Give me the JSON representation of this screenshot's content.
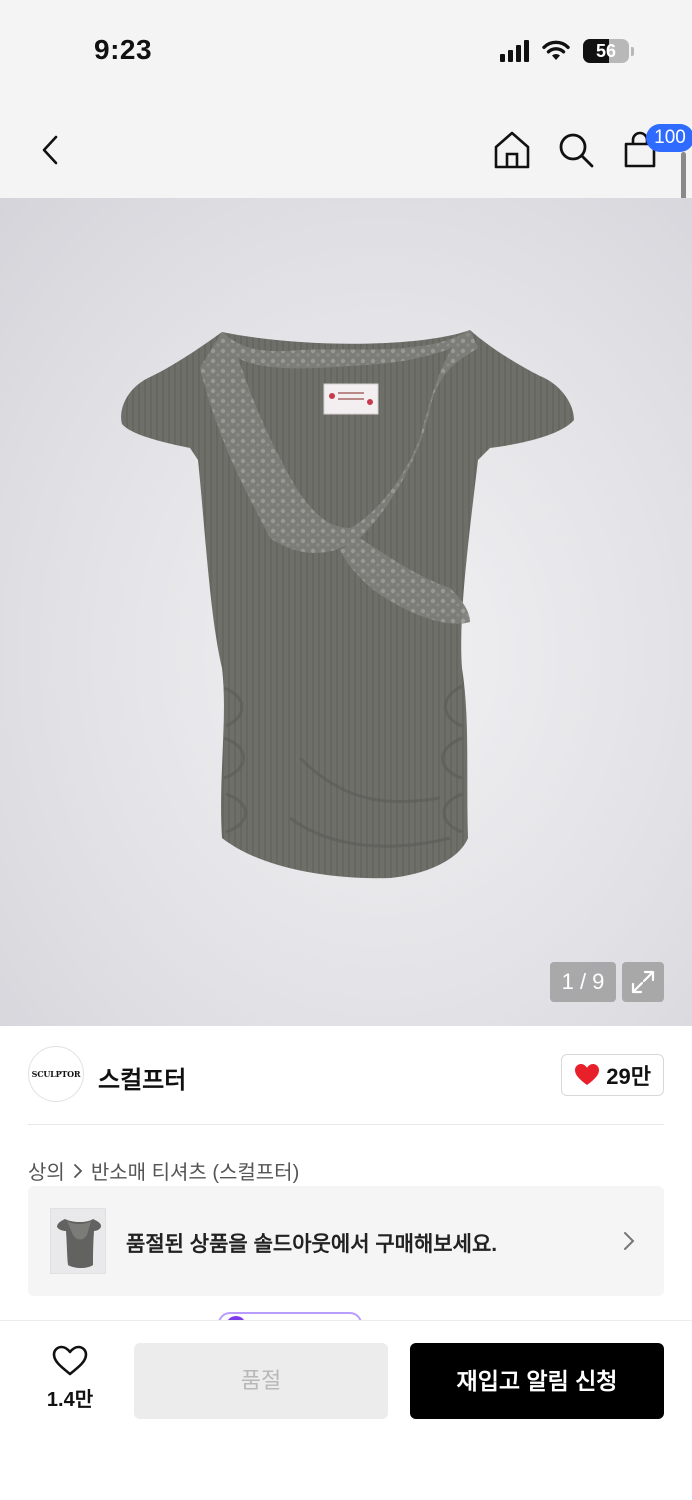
{
  "status_bar": {
    "time": "9:23",
    "battery": "56",
    "battery_level_percent": 56
  },
  "nav": {
    "cart_count": "100"
  },
  "gallery": {
    "counter": "1 / 9"
  },
  "brand": {
    "logo_text": "SCULPTOR",
    "name": "스컬프터",
    "likes": "29만"
  },
  "breadcrumb": {
    "category": "상의",
    "subcategory": "반소매 티셔츠 (스컬프터)"
  },
  "soldout_notice": {
    "text": "품절된 상품을 솔드아웃에서 구매해보세요."
  },
  "bottom": {
    "wish_count": "1.4만",
    "soldout_label": "품절",
    "restock_label": "재입고 알림 신청"
  },
  "colors": {
    "accent_blue": "#2f6bff",
    "heart_red": "#e8202a",
    "purple": "#7c3aed"
  }
}
